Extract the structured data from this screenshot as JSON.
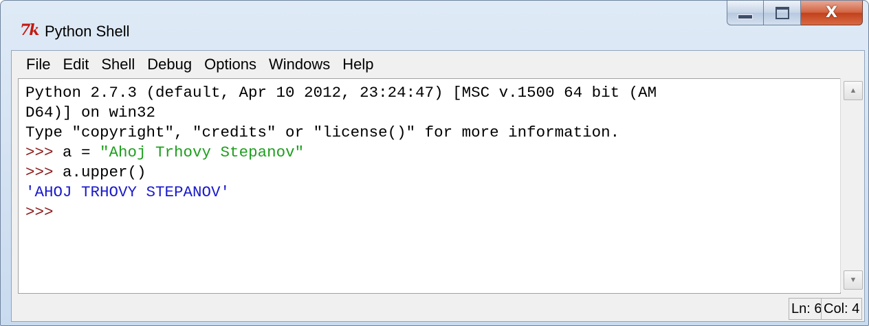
{
  "window": {
    "title": "Python Shell",
    "icon": "idle-tk-icon",
    "controls": {
      "minimize": "minimize-icon",
      "maximize": "maximize-icon",
      "close_label": "X"
    }
  },
  "menu": [
    "File",
    "Edit",
    "Shell",
    "Debug",
    "Options",
    "Windows",
    "Help"
  ],
  "shell": {
    "banner_line1": "Python 2.7.3 (default, Apr 10 2012, 23:24:47) [MSC v.1500 64 bit (AM",
    "banner_line2": "D64)] on win32",
    "banner_line3": "Type \"copyright\", \"credits\" or \"license()\" for more information.",
    "prompt": ">>>",
    "cmd1_prefix": " a = ",
    "cmd1_string": "\"Ahoj Trhovy Stepanov\"",
    "cmd2": " a.upper()",
    "output": "'AHOJ TRHOVY STEPANOV'"
  },
  "status": {
    "line": "Ln: 6",
    "col": "Col: 4"
  },
  "colors": {
    "prompt": "#8b1a1a",
    "string": "#1e9e1e",
    "output": "#1a1acc"
  }
}
